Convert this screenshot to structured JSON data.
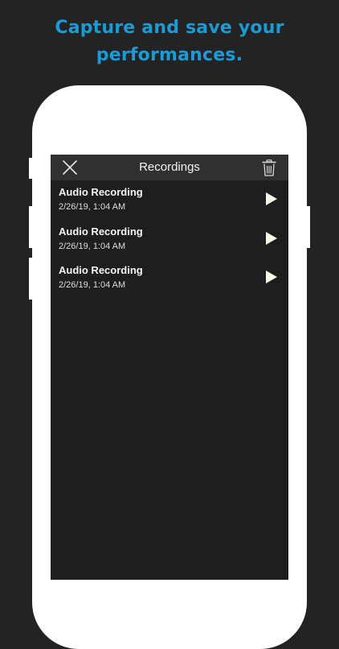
{
  "headline": {
    "line1": "Capture and save your",
    "line2": "performances."
  },
  "navbar": {
    "title": "Recordings",
    "close_icon": "close-icon",
    "trash_icon": "trash-icon"
  },
  "recordings": [
    {
      "title": "Audio Recording",
      "date": "2/26/19, 1:04 AM"
    },
    {
      "title": "Audio Recording",
      "date": "2/26/19, 1:04 AM"
    },
    {
      "title": "Audio Recording",
      "date": "2/26/19, 1:04 AM"
    }
  ],
  "colors": {
    "headline": "#1b9ad6",
    "background": "#232324",
    "screen": "#1e1e1f",
    "navbar": "#303031",
    "play": "#f5f5e8"
  }
}
